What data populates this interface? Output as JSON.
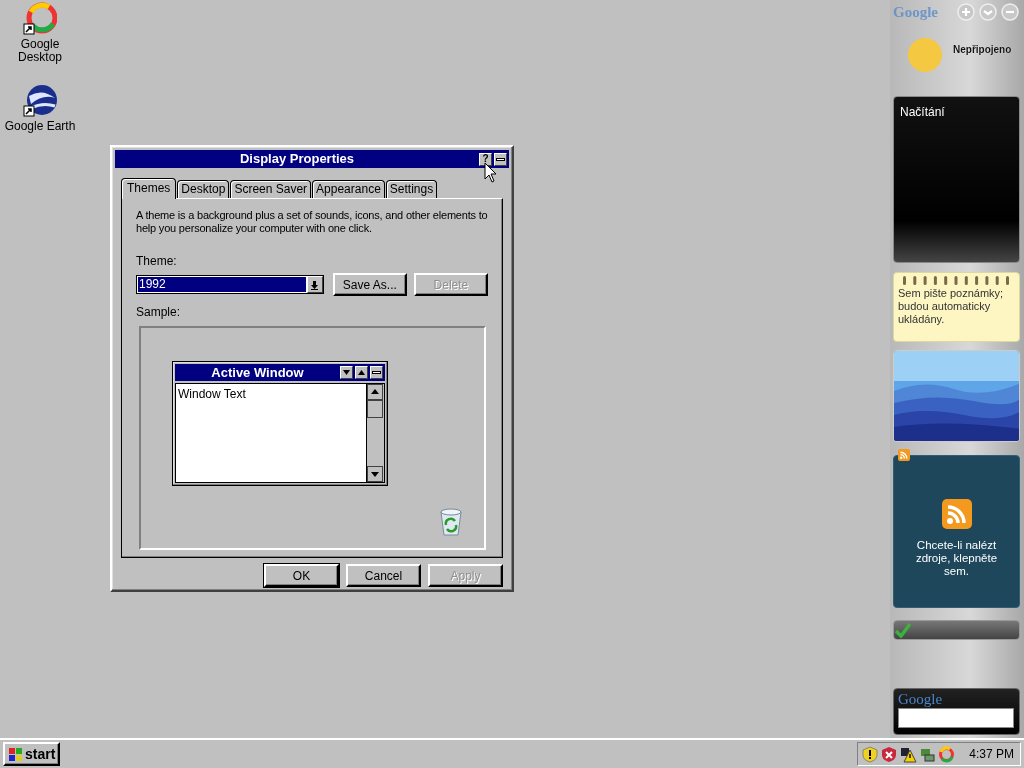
{
  "desktop_icons": [
    {
      "label": "Google Desktop",
      "kind": "desktop"
    },
    {
      "label": "Google Earth",
      "kind": "earth"
    }
  ],
  "dialog": {
    "title": "Display Properties",
    "help_button": "?",
    "tabs": [
      {
        "label": "Themes",
        "selected": true
      },
      {
        "label": "Desktop",
        "selected": false
      },
      {
        "label": "Screen Saver",
        "selected": false
      },
      {
        "label": "Appearance",
        "selected": false
      },
      {
        "label": "Settings",
        "selected": false
      }
    ],
    "description": "A theme is a background plus a set of sounds, icons, and other elements to help you personalize your computer with one click.",
    "theme_label": "Theme:",
    "theme_value": "1992",
    "theme_buttons": [
      {
        "label": "Save As...",
        "disabled": false
      },
      {
        "label": "Delete",
        "disabled": true
      }
    ],
    "sample_label": "Sample:",
    "sample": {
      "window_title": "Active Window",
      "window_text": "Window Text"
    },
    "footer_buttons": [
      {
        "label": "OK",
        "disabled": false,
        "default": true
      },
      {
        "label": "Cancel",
        "disabled": false,
        "default": false
      },
      {
        "label": "Apply",
        "disabled": true,
        "default": false
      }
    ]
  },
  "sidebar": {
    "logo": "Google",
    "weather_status": "Nepřipojeno",
    "news_text": "Načítání",
    "note_text": "Sem pište poznámky; budou automaticky ukládány.",
    "feed_text": "Chcete-li nalézt zdroje, klepněte sem.",
    "search_logo": "Google"
  },
  "taskbar": {
    "start_label": "start",
    "clock": "4:37 PM"
  }
}
